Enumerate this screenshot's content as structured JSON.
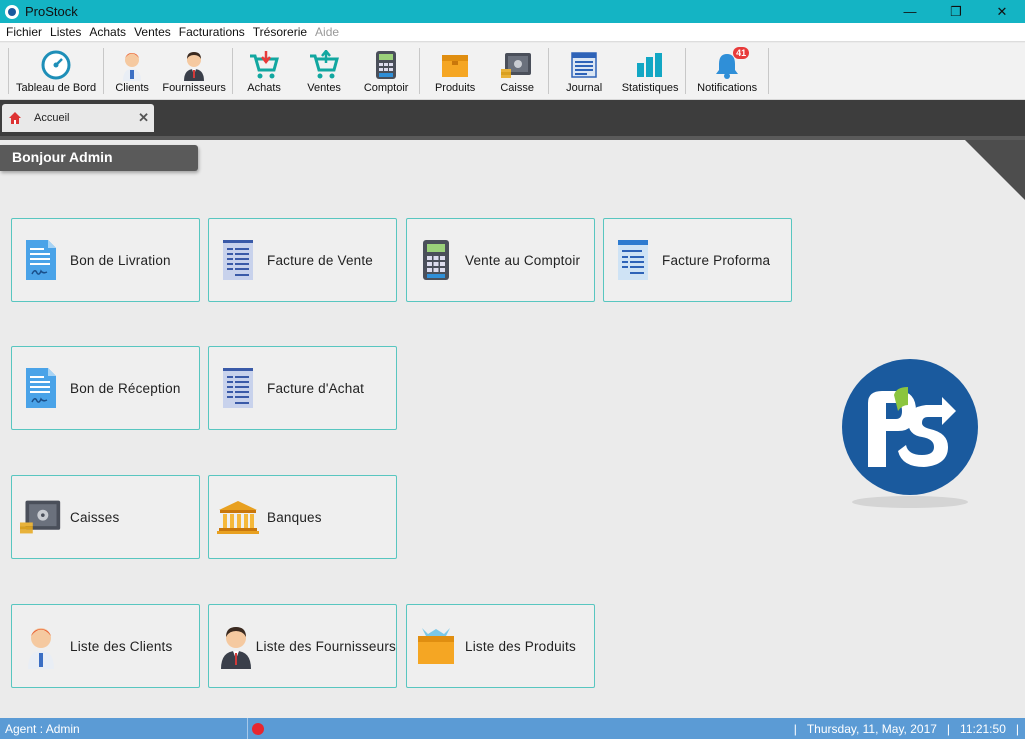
{
  "window": {
    "title": "ProStock",
    "minimize": "—",
    "maximize": "❐",
    "close": "✕"
  },
  "menu": [
    "Fichier",
    "Listes",
    "Achats",
    "Ventes",
    "Facturations",
    "Trésorerie",
    "Aide"
  ],
  "toolbar": {
    "dashboard": "Tableau de Bord",
    "clients": "Clients",
    "suppliers": "Fournisseurs",
    "purchases": "Achats",
    "sales": "Ventes",
    "counter": "Comptoir",
    "products": "Produits",
    "cashbox": "Caisse",
    "journal": "Journal",
    "stats": "Statistiques",
    "notifications": "Notifications",
    "notif_count": "41"
  },
  "tab": {
    "label": "Accueil",
    "close": "✕"
  },
  "greeting": "Bonjour Admin",
  "tiles": {
    "delivery_note": "Bon de Livration",
    "sales_invoice": "Facture de Vente",
    "counter_sale": "Vente au Comptoir",
    "proforma": "Facture Proforma",
    "receipt_note": "Bon de Réception",
    "purchase_invoice": "Facture d'Achat",
    "cashboxes": "Caisses",
    "banks": "Banques",
    "clients_list": "Liste des Clients",
    "suppliers_list": "Liste des Fournisseurs",
    "products_list": "Liste des Produits"
  },
  "status": {
    "agent": "Agent : Admin",
    "date": "Thursday, 11,  May, 2017",
    "time": "11:21:50",
    "sep": "|"
  },
  "colors": {
    "titlebar": "#14b4c4",
    "accent": "#58c6c0",
    "statusbar": "#5b9bd5",
    "logo": "#1a5a9e"
  }
}
